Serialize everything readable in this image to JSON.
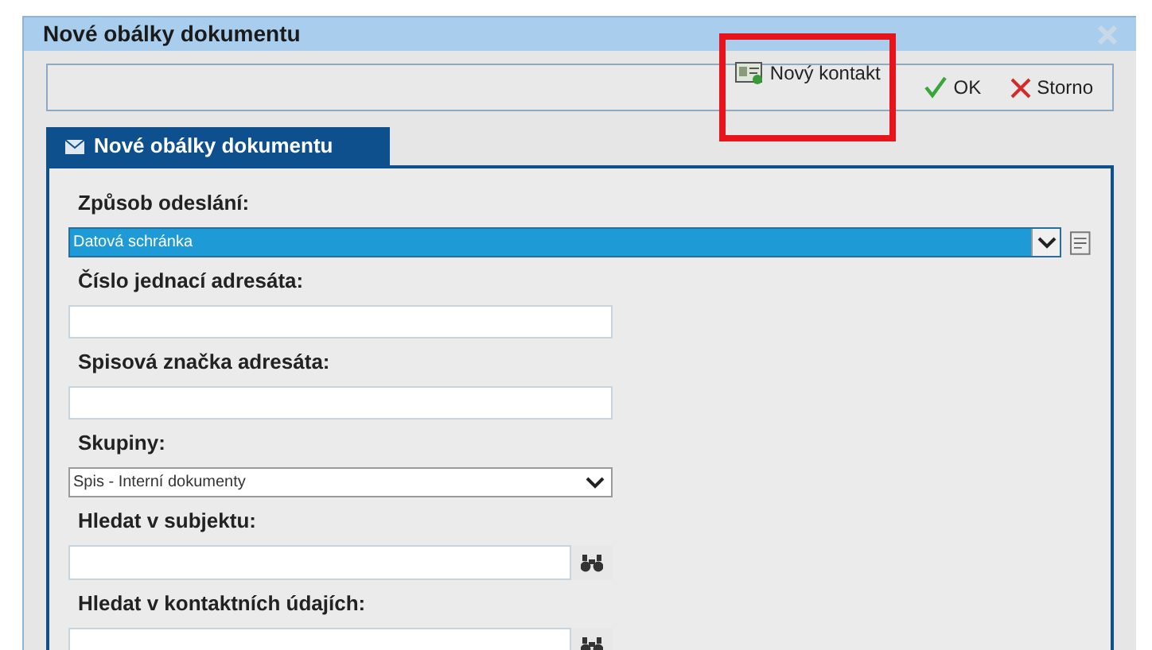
{
  "window": {
    "title": "Nové obálky dokumentu"
  },
  "toolbar": {
    "buttons": [
      {
        "kind": "new-contact",
        "label": "Nový kontakt",
        "highlighted": true
      },
      {
        "kind": "ok",
        "label": "OK",
        "highlighted": false
      },
      {
        "kind": "cancel",
        "label": "Storno",
        "highlighted": false
      }
    ]
  },
  "tabs": [
    {
      "label": "Nové obálky dokumentu",
      "selected": true
    }
  ],
  "fields": [
    {
      "kind": "select-wide",
      "label": "Způsob odeslání:",
      "value": "Datová schránka",
      "focused": true
    },
    {
      "kind": "text",
      "label": "Číslo jednací adresáta:",
      "focused": false
    },
    {
      "kind": "text",
      "label": "Spisová značka adresáta:",
      "focused": false
    },
    {
      "kind": "select",
      "label": "Skupiny:",
      "value": "Spis - Interní dokumenty",
      "focused": false
    },
    {
      "kind": "search",
      "label": "Hledat v subjektu:",
      "focused": false
    },
    {
      "kind": "search",
      "label": "Hledat v kontaktních údajích:",
      "focused": false
    }
  ]
}
